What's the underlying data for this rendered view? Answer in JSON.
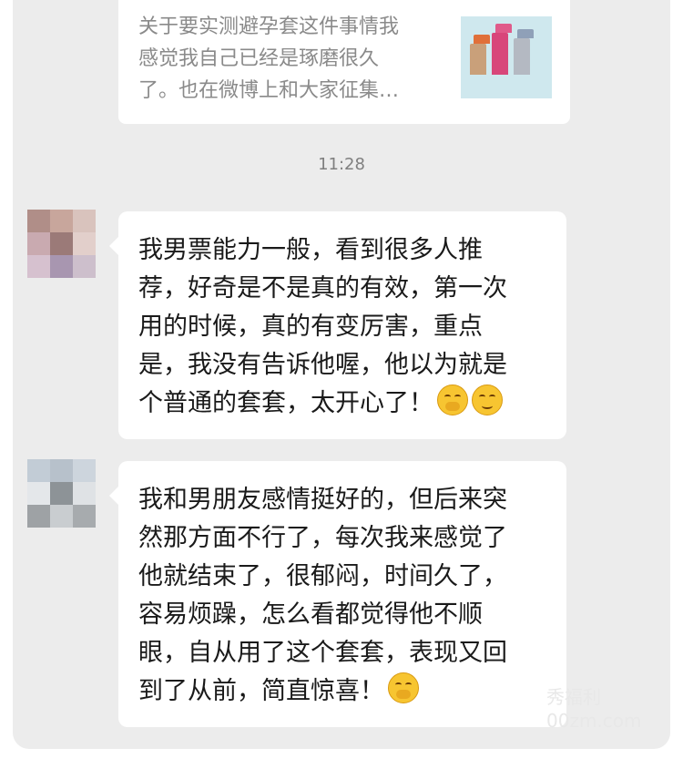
{
  "link_card": {
    "text": "关于要实测避孕套这件事情我\n感觉我自己已经是琢磨很久\n了。也在微博上和大家征集…",
    "thumbnail_icon": "product-thumbnail-image"
  },
  "timestamp": "11:28",
  "messages": [
    {
      "lines": [
        "我男票能力一般，看到很多人推",
        "荐，好奇是不是真的有效，第一次",
        "用的时候，真的有变厉害，重点",
        "是，我没有告诉他喔，他以为就是",
        "个普通的套套，太开心了！"
      ],
      "emojis": [
        "laughing-tears-emoji",
        "happy-blush-emoji"
      ]
    },
    {
      "lines": [
        "我和男朋友感情挺好的，但后来突",
        "然那方面不行了，每次我来感觉了",
        "他就结束了，很郁闷，时间久了，",
        "容易烦躁，怎么看都觉得他不顺",
        "眼，自从用了这个套套，表现又回",
        "到了从前，简直惊喜！"
      ],
      "emojis": [
        "thinking-smirk-emoji"
      ]
    }
  ],
  "watermark": {
    "line1": "秀福利",
    "line2": "00zm.com"
  },
  "colors": {
    "chat_background": "#ececec",
    "bubble": "#ffffff",
    "link_text": "#8a8a8a",
    "timestamp": "#7f7f7f"
  }
}
